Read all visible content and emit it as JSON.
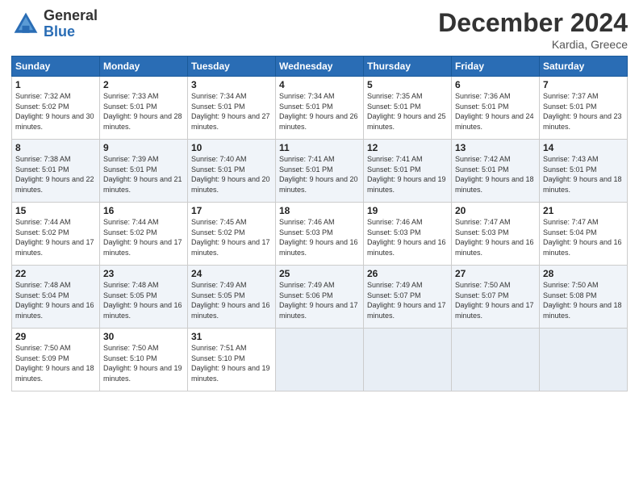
{
  "logo": {
    "general": "General",
    "blue": "Blue"
  },
  "title": "December 2024",
  "subtitle": "Kardia, Greece",
  "days": [
    "Sunday",
    "Monday",
    "Tuesday",
    "Wednesday",
    "Thursday",
    "Friday",
    "Saturday"
  ],
  "weeks": [
    [
      {
        "num": "1",
        "sunrise": "Sunrise: 7:32 AM",
        "sunset": "Sunset: 5:02 PM",
        "daylight": "Daylight: 9 hours and 30 minutes."
      },
      {
        "num": "2",
        "sunrise": "Sunrise: 7:33 AM",
        "sunset": "Sunset: 5:01 PM",
        "daylight": "Daylight: 9 hours and 28 minutes."
      },
      {
        "num": "3",
        "sunrise": "Sunrise: 7:34 AM",
        "sunset": "Sunset: 5:01 PM",
        "daylight": "Daylight: 9 hours and 27 minutes."
      },
      {
        "num": "4",
        "sunrise": "Sunrise: 7:34 AM",
        "sunset": "Sunset: 5:01 PM",
        "daylight": "Daylight: 9 hours and 26 minutes."
      },
      {
        "num": "5",
        "sunrise": "Sunrise: 7:35 AM",
        "sunset": "Sunset: 5:01 PM",
        "daylight": "Daylight: 9 hours and 25 minutes."
      },
      {
        "num": "6",
        "sunrise": "Sunrise: 7:36 AM",
        "sunset": "Sunset: 5:01 PM",
        "daylight": "Daylight: 9 hours and 24 minutes."
      },
      {
        "num": "7",
        "sunrise": "Sunrise: 7:37 AM",
        "sunset": "Sunset: 5:01 PM",
        "daylight": "Daylight: 9 hours and 23 minutes."
      }
    ],
    [
      {
        "num": "8",
        "sunrise": "Sunrise: 7:38 AM",
        "sunset": "Sunset: 5:01 PM",
        "daylight": "Daylight: 9 hours and 22 minutes."
      },
      {
        "num": "9",
        "sunrise": "Sunrise: 7:39 AM",
        "sunset": "Sunset: 5:01 PM",
        "daylight": "Daylight: 9 hours and 21 minutes."
      },
      {
        "num": "10",
        "sunrise": "Sunrise: 7:40 AM",
        "sunset": "Sunset: 5:01 PM",
        "daylight": "Daylight: 9 hours and 20 minutes."
      },
      {
        "num": "11",
        "sunrise": "Sunrise: 7:41 AM",
        "sunset": "Sunset: 5:01 PM",
        "daylight": "Daylight: 9 hours and 20 minutes."
      },
      {
        "num": "12",
        "sunrise": "Sunrise: 7:41 AM",
        "sunset": "Sunset: 5:01 PM",
        "daylight": "Daylight: 9 hours and 19 minutes."
      },
      {
        "num": "13",
        "sunrise": "Sunrise: 7:42 AM",
        "sunset": "Sunset: 5:01 PM",
        "daylight": "Daylight: 9 hours and 18 minutes."
      },
      {
        "num": "14",
        "sunrise": "Sunrise: 7:43 AM",
        "sunset": "Sunset: 5:01 PM",
        "daylight": "Daylight: 9 hours and 18 minutes."
      }
    ],
    [
      {
        "num": "15",
        "sunrise": "Sunrise: 7:44 AM",
        "sunset": "Sunset: 5:02 PM",
        "daylight": "Daylight: 9 hours and 17 minutes."
      },
      {
        "num": "16",
        "sunrise": "Sunrise: 7:44 AM",
        "sunset": "Sunset: 5:02 PM",
        "daylight": "Daylight: 9 hours and 17 minutes."
      },
      {
        "num": "17",
        "sunrise": "Sunrise: 7:45 AM",
        "sunset": "Sunset: 5:02 PM",
        "daylight": "Daylight: 9 hours and 17 minutes."
      },
      {
        "num": "18",
        "sunrise": "Sunrise: 7:46 AM",
        "sunset": "Sunset: 5:03 PM",
        "daylight": "Daylight: 9 hours and 16 minutes."
      },
      {
        "num": "19",
        "sunrise": "Sunrise: 7:46 AM",
        "sunset": "Sunset: 5:03 PM",
        "daylight": "Daylight: 9 hours and 16 minutes."
      },
      {
        "num": "20",
        "sunrise": "Sunrise: 7:47 AM",
        "sunset": "Sunset: 5:03 PM",
        "daylight": "Daylight: 9 hours and 16 minutes."
      },
      {
        "num": "21",
        "sunrise": "Sunrise: 7:47 AM",
        "sunset": "Sunset: 5:04 PM",
        "daylight": "Daylight: 9 hours and 16 minutes."
      }
    ],
    [
      {
        "num": "22",
        "sunrise": "Sunrise: 7:48 AM",
        "sunset": "Sunset: 5:04 PM",
        "daylight": "Daylight: 9 hours and 16 minutes."
      },
      {
        "num": "23",
        "sunrise": "Sunrise: 7:48 AM",
        "sunset": "Sunset: 5:05 PM",
        "daylight": "Daylight: 9 hours and 16 minutes."
      },
      {
        "num": "24",
        "sunrise": "Sunrise: 7:49 AM",
        "sunset": "Sunset: 5:05 PM",
        "daylight": "Daylight: 9 hours and 16 minutes."
      },
      {
        "num": "25",
        "sunrise": "Sunrise: 7:49 AM",
        "sunset": "Sunset: 5:06 PM",
        "daylight": "Daylight: 9 hours and 17 minutes."
      },
      {
        "num": "26",
        "sunrise": "Sunrise: 7:49 AM",
        "sunset": "Sunset: 5:07 PM",
        "daylight": "Daylight: 9 hours and 17 minutes."
      },
      {
        "num": "27",
        "sunrise": "Sunrise: 7:50 AM",
        "sunset": "Sunset: 5:07 PM",
        "daylight": "Daylight: 9 hours and 17 minutes."
      },
      {
        "num": "28",
        "sunrise": "Sunrise: 7:50 AM",
        "sunset": "Sunset: 5:08 PM",
        "daylight": "Daylight: 9 hours and 18 minutes."
      }
    ],
    [
      {
        "num": "29",
        "sunrise": "Sunrise: 7:50 AM",
        "sunset": "Sunset: 5:09 PM",
        "daylight": "Daylight: 9 hours and 18 minutes."
      },
      {
        "num": "30",
        "sunrise": "Sunrise: 7:50 AM",
        "sunset": "Sunset: 5:10 PM",
        "daylight": "Daylight: 9 hours and 19 minutes."
      },
      {
        "num": "31",
        "sunrise": "Sunrise: 7:51 AM",
        "sunset": "Sunset: 5:10 PM",
        "daylight": "Daylight: 9 hours and 19 minutes."
      },
      null,
      null,
      null,
      null
    ]
  ]
}
